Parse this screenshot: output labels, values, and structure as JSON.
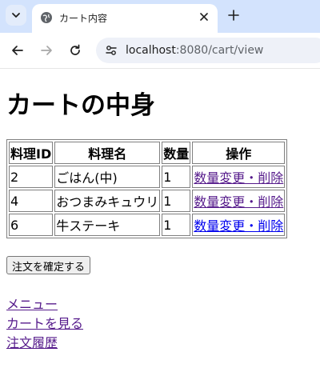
{
  "browser": {
    "tab_title": "カート内容",
    "url_host": "localhost",
    "url_path": ":8080/cart/view"
  },
  "page": {
    "title": "カートの中身",
    "table": {
      "headers": [
        "料理ID",
        "料理名",
        "数量",
        "操作"
      ],
      "rows": [
        {
          "id": "2",
          "name": "ごはん(中)",
          "qty": "1",
          "action": "数量変更・削除"
        },
        {
          "id": "4",
          "name": "おつまみキュウリ",
          "qty": "1",
          "action": "数量変更・削除"
        },
        {
          "id": "6",
          "name": "牛ステーキ",
          "qty": "1",
          "action": "数量変更・削除"
        }
      ]
    },
    "confirm_button": "注文を確定する",
    "links": {
      "menu": "メニュー",
      "view_cart": "カートを見る",
      "order_history": "注文履歴"
    }
  },
  "colors": {
    "visited_link": "#551a8b",
    "unvisited_link": "#0000ee",
    "tabstrip_bg": "#d3e3fd"
  }
}
